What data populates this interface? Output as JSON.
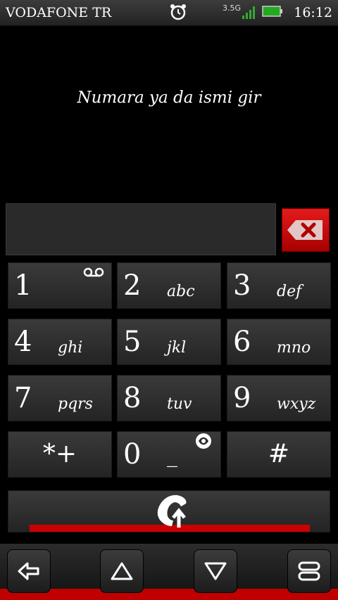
{
  "status_bar": {
    "carrier": "VODAFONE TR",
    "network": "3.5G",
    "time": "16:12",
    "icons": [
      "alarm-clock-icon",
      "signal-icon",
      "battery-icon"
    ]
  },
  "dialer": {
    "prompt": "Numara ya da ismi gir",
    "number_value": ""
  },
  "keys": [
    {
      "digit": "1",
      "letters": "",
      "icon": "voicemail-icon"
    },
    {
      "digit": "2",
      "letters": "abc"
    },
    {
      "digit": "3",
      "letters": "def"
    },
    {
      "digit": "4",
      "letters": "ghi"
    },
    {
      "digit": "5",
      "letters": "jkl"
    },
    {
      "digit": "6",
      "letters": "mno"
    },
    {
      "digit": "7",
      "letters": "pqrs"
    },
    {
      "digit": "8",
      "letters": "tuv"
    },
    {
      "digit": "9",
      "letters": "wxyz"
    },
    {
      "digit": "*+",
      "letters": ""
    },
    {
      "digit": "0",
      "letters": "_",
      "icon": "globe-icon"
    },
    {
      "digit": "#",
      "letters": ""
    }
  ],
  "colors": {
    "accent": "#cc0000",
    "key_bg": "#2f2f2f",
    "background": "#000000"
  },
  "nav_bar": {
    "icons": [
      "back-arrow-icon",
      "up-triangle-icon",
      "down-triangle-icon",
      "menu-icon"
    ]
  }
}
